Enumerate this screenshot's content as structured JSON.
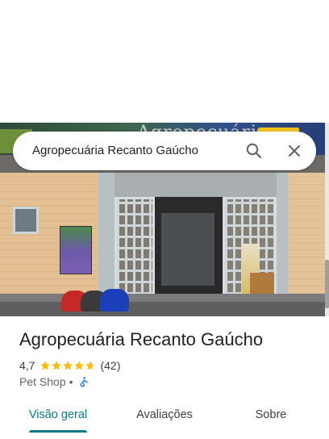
{
  "search": {
    "query": "Agropecuária Recanto Gaúcho"
  },
  "photo": {
    "sign_text": "Agropecuária"
  },
  "place": {
    "name": "Agropecuária Recanto Gaúcho",
    "rating": "4,7",
    "stars": 4.7,
    "review_count": "(42)",
    "category": "Pet Shop",
    "separator": "•",
    "accessibility_icon": "wheelchair-icon"
  },
  "tabs": [
    {
      "label": "Visão geral",
      "active": true
    },
    {
      "label": "Avaliações",
      "active": false
    },
    {
      "label": "Sobre",
      "active": false
    }
  ],
  "colors": {
    "star": "#fbbc04",
    "accent": "#0b7a85",
    "accessibility": "#1a73e8"
  }
}
